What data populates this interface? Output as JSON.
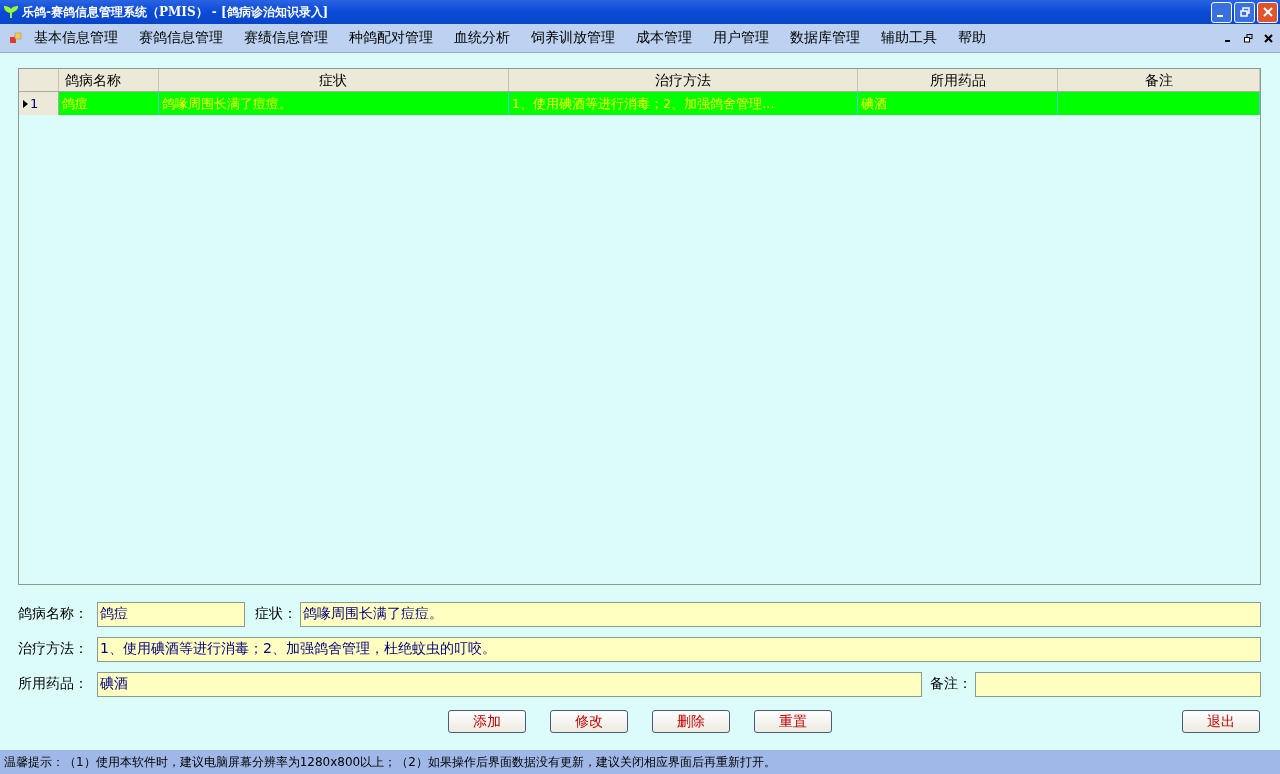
{
  "window": {
    "title": "乐鸽-赛鸽信息管理系统（PMIS） - [鸽病诊治知识录入]"
  },
  "menu": [
    "基本信息管理",
    "赛鸽信息管理",
    "赛绩信息管理",
    "种鸽配对管理",
    "血统分析",
    "饲养训放管理",
    "成本管理",
    "用户管理",
    "数据库管理",
    "辅助工具",
    "帮助"
  ],
  "table": {
    "columns": [
      "鸽病名称",
      "症状",
      "治疗方法",
      "所用药品",
      "备注"
    ],
    "rows": [
      {
        "number": "1",
        "selected": true,
        "cells": [
          "鸽痘",
          "鸽喙周围长满了痘痘。",
          "1、使用碘酒等进行消毒；2、加强鸽舍管理...",
          "碘酒",
          ""
        ]
      }
    ]
  },
  "form": {
    "name": {
      "label": "鸽病名称：",
      "value": "鸽痘"
    },
    "symptom": {
      "label": "症状：",
      "value": "鸽喙周围长满了痘痘。"
    },
    "treatment": {
      "label": "治疗方法：",
      "value": "1、使用碘酒等进行消毒；2、加强鸽舍管理，杜绝蚊虫的叮咬。"
    },
    "medicine": {
      "label": "所用药品：",
      "value": "碘酒"
    },
    "note": {
      "label": "备注："
    }
  },
  "buttons": [
    "添加",
    "修改",
    "删除",
    "重置"
  ],
  "exit_button": "退出",
  "status_bar": "温馨提示：（1）使用本软件时，建议电脑屏幕分辨率为1280x800以上；（2）如果操作后界面数据没有更新，建议关闭相应界面后再重新打开。"
}
